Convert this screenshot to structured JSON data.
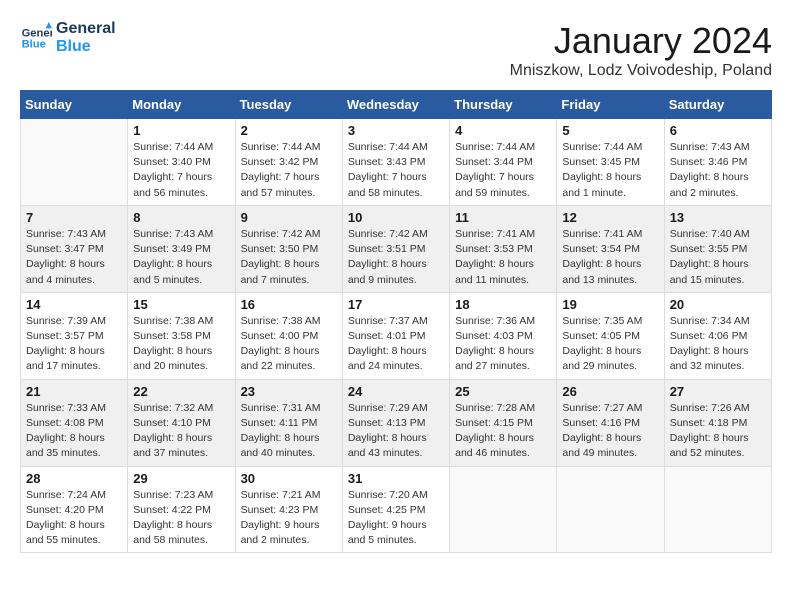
{
  "header": {
    "logo_line1": "General",
    "logo_line2": "Blue",
    "month": "January 2024",
    "location": "Mniszkow, Lodz Voivodeship, Poland"
  },
  "days_of_week": [
    "Sunday",
    "Monday",
    "Tuesday",
    "Wednesday",
    "Thursday",
    "Friday",
    "Saturday"
  ],
  "weeks": [
    [
      {
        "day": "",
        "detail": ""
      },
      {
        "day": "1",
        "detail": "Sunrise: 7:44 AM\nSunset: 3:40 PM\nDaylight: 7 hours\nand 56 minutes."
      },
      {
        "day": "2",
        "detail": "Sunrise: 7:44 AM\nSunset: 3:42 PM\nDaylight: 7 hours\nand 57 minutes."
      },
      {
        "day": "3",
        "detail": "Sunrise: 7:44 AM\nSunset: 3:43 PM\nDaylight: 7 hours\nand 58 minutes."
      },
      {
        "day": "4",
        "detail": "Sunrise: 7:44 AM\nSunset: 3:44 PM\nDaylight: 7 hours\nand 59 minutes."
      },
      {
        "day": "5",
        "detail": "Sunrise: 7:44 AM\nSunset: 3:45 PM\nDaylight: 8 hours\nand 1 minute."
      },
      {
        "day": "6",
        "detail": "Sunrise: 7:43 AM\nSunset: 3:46 PM\nDaylight: 8 hours\nand 2 minutes."
      }
    ],
    [
      {
        "day": "7",
        "detail": "Sunrise: 7:43 AM\nSunset: 3:47 PM\nDaylight: 8 hours\nand 4 minutes."
      },
      {
        "day": "8",
        "detail": "Sunrise: 7:43 AM\nSunset: 3:49 PM\nDaylight: 8 hours\nand 5 minutes."
      },
      {
        "day": "9",
        "detail": "Sunrise: 7:42 AM\nSunset: 3:50 PM\nDaylight: 8 hours\nand 7 minutes."
      },
      {
        "day": "10",
        "detail": "Sunrise: 7:42 AM\nSunset: 3:51 PM\nDaylight: 8 hours\nand 9 minutes."
      },
      {
        "day": "11",
        "detail": "Sunrise: 7:41 AM\nSunset: 3:53 PM\nDaylight: 8 hours\nand 11 minutes."
      },
      {
        "day": "12",
        "detail": "Sunrise: 7:41 AM\nSunset: 3:54 PM\nDaylight: 8 hours\nand 13 minutes."
      },
      {
        "day": "13",
        "detail": "Sunrise: 7:40 AM\nSunset: 3:55 PM\nDaylight: 8 hours\nand 15 minutes."
      }
    ],
    [
      {
        "day": "14",
        "detail": "Sunrise: 7:39 AM\nSunset: 3:57 PM\nDaylight: 8 hours\nand 17 minutes."
      },
      {
        "day": "15",
        "detail": "Sunrise: 7:38 AM\nSunset: 3:58 PM\nDaylight: 8 hours\nand 20 minutes."
      },
      {
        "day": "16",
        "detail": "Sunrise: 7:38 AM\nSunset: 4:00 PM\nDaylight: 8 hours\nand 22 minutes."
      },
      {
        "day": "17",
        "detail": "Sunrise: 7:37 AM\nSunset: 4:01 PM\nDaylight: 8 hours\nand 24 minutes."
      },
      {
        "day": "18",
        "detail": "Sunrise: 7:36 AM\nSunset: 4:03 PM\nDaylight: 8 hours\nand 27 minutes."
      },
      {
        "day": "19",
        "detail": "Sunrise: 7:35 AM\nSunset: 4:05 PM\nDaylight: 8 hours\nand 29 minutes."
      },
      {
        "day": "20",
        "detail": "Sunrise: 7:34 AM\nSunset: 4:06 PM\nDaylight: 8 hours\nand 32 minutes."
      }
    ],
    [
      {
        "day": "21",
        "detail": "Sunrise: 7:33 AM\nSunset: 4:08 PM\nDaylight: 8 hours\nand 35 minutes."
      },
      {
        "day": "22",
        "detail": "Sunrise: 7:32 AM\nSunset: 4:10 PM\nDaylight: 8 hours\nand 37 minutes."
      },
      {
        "day": "23",
        "detail": "Sunrise: 7:31 AM\nSunset: 4:11 PM\nDaylight: 8 hours\nand 40 minutes."
      },
      {
        "day": "24",
        "detail": "Sunrise: 7:29 AM\nSunset: 4:13 PM\nDaylight: 8 hours\nand 43 minutes."
      },
      {
        "day": "25",
        "detail": "Sunrise: 7:28 AM\nSunset: 4:15 PM\nDaylight: 8 hours\nand 46 minutes."
      },
      {
        "day": "26",
        "detail": "Sunrise: 7:27 AM\nSunset: 4:16 PM\nDaylight: 8 hours\nand 49 minutes."
      },
      {
        "day": "27",
        "detail": "Sunrise: 7:26 AM\nSunset: 4:18 PM\nDaylight: 8 hours\nand 52 minutes."
      }
    ],
    [
      {
        "day": "28",
        "detail": "Sunrise: 7:24 AM\nSunset: 4:20 PM\nDaylight: 8 hours\nand 55 minutes."
      },
      {
        "day": "29",
        "detail": "Sunrise: 7:23 AM\nSunset: 4:22 PM\nDaylight: 8 hours\nand 58 minutes."
      },
      {
        "day": "30",
        "detail": "Sunrise: 7:21 AM\nSunset: 4:23 PM\nDaylight: 9 hours\nand 2 minutes."
      },
      {
        "day": "31",
        "detail": "Sunrise: 7:20 AM\nSunset: 4:25 PM\nDaylight: 9 hours\nand 5 minutes."
      },
      {
        "day": "",
        "detail": ""
      },
      {
        "day": "",
        "detail": ""
      },
      {
        "day": "",
        "detail": ""
      }
    ]
  ]
}
